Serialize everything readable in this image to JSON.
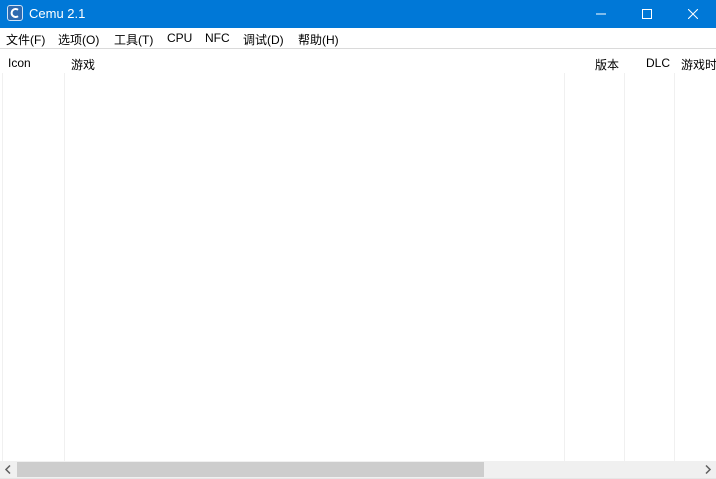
{
  "window": {
    "title": "Cemu 2.1",
    "titlebar_color": "#0078d7",
    "app_icon": "cemu-logo-icon"
  },
  "window_controls": {
    "minimize_icon": "minimize-icon",
    "maximize_icon": "maximize-icon",
    "close_icon": "close-icon"
  },
  "menu": {
    "file": "文件(F)",
    "options": "选项(O)",
    "tools": "工具(T)",
    "cpu": "CPU",
    "nfc": "NFC",
    "debug": "调试(D)",
    "help": "帮助(H)"
  },
  "game_list": {
    "columns": {
      "icon": "Icon",
      "game": "游戏",
      "version": "版本",
      "dlc": "DLC",
      "playtime": "游戏时"
    },
    "rows": []
  },
  "scrollbar": {
    "left_icon": "scroll-left-arrow-icon",
    "right_icon": "scroll-right-arrow-icon"
  }
}
